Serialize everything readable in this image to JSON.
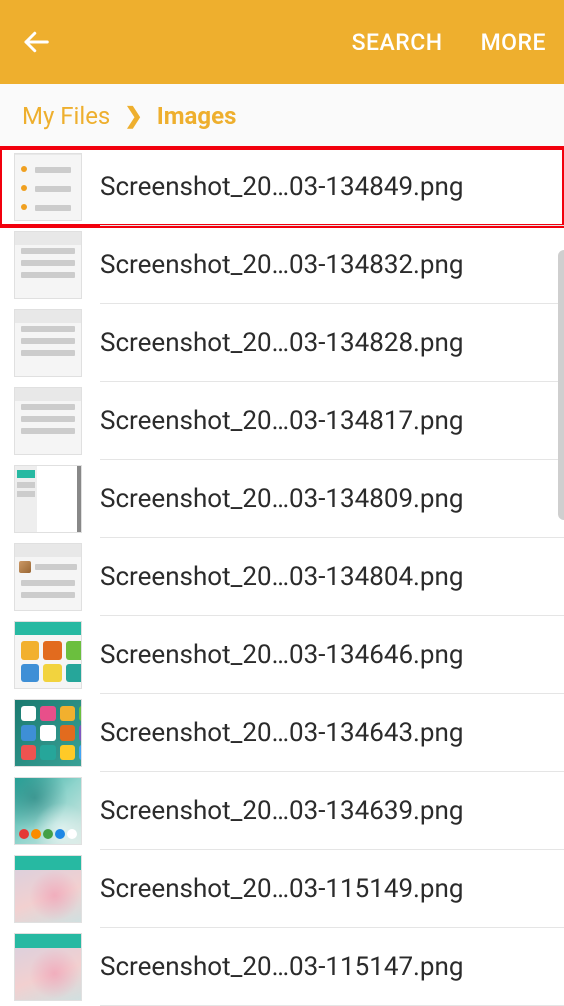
{
  "toolbar": {
    "actions": {
      "search": "SEARCH",
      "more": "MORE"
    }
  },
  "breadcrumb": {
    "root": "My Files",
    "current": "Images"
  },
  "files": [
    {
      "name": "Screenshot_20…03-134849.png",
      "highlighted": true,
      "thumbStyle": "list-orange"
    },
    {
      "name": "Screenshot_20…03-134832.png",
      "highlighted": false,
      "thumbStyle": "list-grey"
    },
    {
      "name": "Screenshot_20…03-134828.png",
      "highlighted": false,
      "thumbStyle": "list-grey"
    },
    {
      "name": "Screenshot_20…03-134817.png",
      "highlighted": false,
      "thumbStyle": "list-grey"
    },
    {
      "name": "Screenshot_20…03-134809.png",
      "highlighted": false,
      "thumbStyle": "sidebar-teal"
    },
    {
      "name": "Screenshot_20…03-134804.png",
      "highlighted": false,
      "thumbStyle": "list-photo"
    },
    {
      "name": "Screenshot_20…03-134646.png",
      "highlighted": false,
      "thumbStyle": "app-grid-light"
    },
    {
      "name": "Screenshot_20…03-134643.png",
      "highlighted": false,
      "thumbStyle": "app-grid-dark"
    },
    {
      "name": "Screenshot_20…03-134639.png",
      "highlighted": false,
      "thumbStyle": "home-wallpaper"
    },
    {
      "name": "Screenshot_20…03-115149.png",
      "highlighted": false,
      "thumbStyle": "wallpaper-pink"
    },
    {
      "name": "Screenshot_20…03-115147.png",
      "highlighted": false,
      "thumbStyle": "wallpaper-pink"
    }
  ]
}
